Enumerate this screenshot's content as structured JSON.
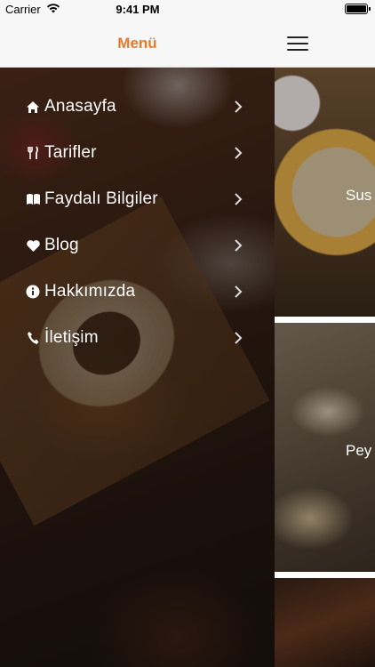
{
  "status_bar": {
    "carrier": "Carrier",
    "time": "9:41 PM"
  },
  "menu": {
    "title": "Menü",
    "title_color": "#e8792b",
    "items": [
      {
        "label": "Anasayfa",
        "icon": "home-icon"
      },
      {
        "label": "Tarifler",
        "icon": "cutlery-icon"
      },
      {
        "label": "Faydalı Bilgiler",
        "icon": "book-icon"
      },
      {
        "label": "Blog",
        "icon": "heart-icon"
      },
      {
        "label": "Hakkımızda",
        "icon": "info-icon"
      },
      {
        "label": "İletişim",
        "icon": "phone-icon"
      }
    ]
  },
  "content": {
    "cards": [
      {
        "title": "Sus"
      },
      {
        "title": "Pey"
      },
      {
        "title": ""
      }
    ]
  }
}
